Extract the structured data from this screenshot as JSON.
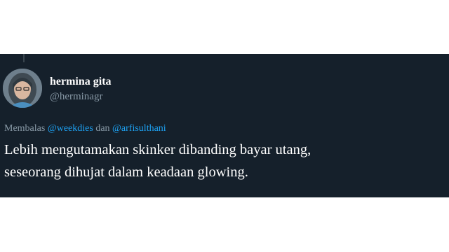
{
  "colors": {
    "background": "#15202b",
    "text": "#ffffff",
    "secondary_text": "#8899a6",
    "link": "#1da1f2"
  },
  "tweet": {
    "author": {
      "display_name": "hermina gita",
      "handle": "@herminagr"
    },
    "reply": {
      "prefix": "Membalas",
      "mention_1": "@weekdies",
      "conjunction": "dan",
      "mention_2": "@arfisulthani"
    },
    "text_line_1": "Lebih mengutamakan skinker dibanding bayar utang,",
    "text_line_2": "seseorang dihujat dalam keadaan glowing."
  }
}
